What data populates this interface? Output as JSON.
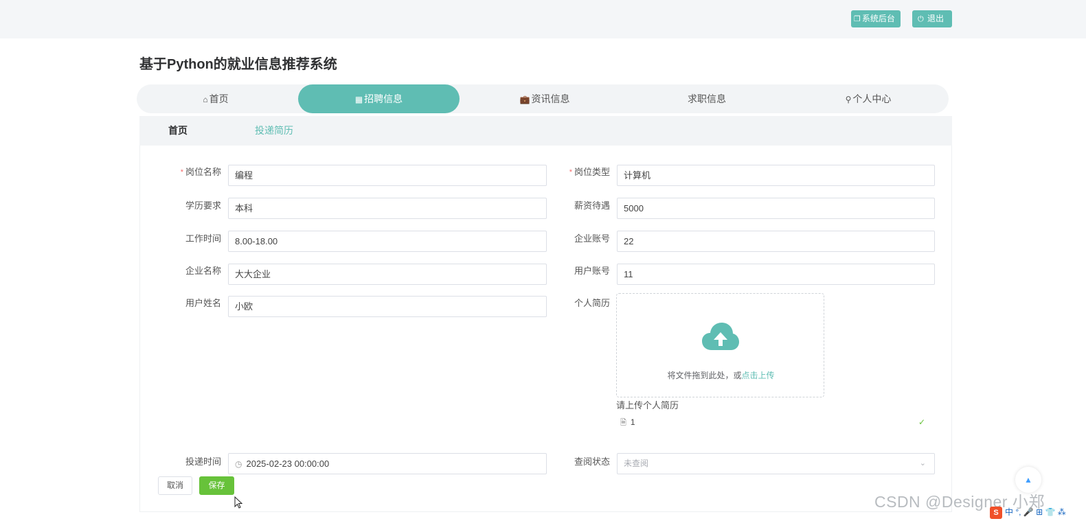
{
  "header": {
    "admin_label": "系统后台",
    "logout_label": "退出",
    "admin_icon": "copy-icon",
    "logout_icon": "power-icon"
  },
  "site_title": "基于Python的就业信息推荐系统",
  "nav": {
    "items": [
      {
        "label": "首页",
        "icon": "home-icon",
        "active": false
      },
      {
        "label": "招聘信息",
        "icon": "grid-icon",
        "active": true
      },
      {
        "label": "资讯信息",
        "icon": "briefcase-icon",
        "active": false
      },
      {
        "label": "求职信息",
        "icon": "",
        "active": false
      },
      {
        "label": "个人中心",
        "icon": "user-icon",
        "active": false
      }
    ]
  },
  "subtabs": {
    "home": "首页",
    "apply": "投递简历"
  },
  "form": {
    "job_name": {
      "label": "岗位名称",
      "value": "编程",
      "required": true
    },
    "job_type": {
      "label": "岗位类型",
      "value": "计算机",
      "required": true
    },
    "education": {
      "label": "学历要求",
      "value": "本科"
    },
    "salary": {
      "label": "薪资待遇",
      "value": "5000"
    },
    "work_time": {
      "label": "工作时间",
      "value": "8.00-18.00"
    },
    "company_account": {
      "label": "企业账号",
      "value": "22"
    },
    "company_name": {
      "label": "企业名称",
      "value": "大大企业"
    },
    "user_account": {
      "label": "用户账号",
      "value": "11"
    },
    "user_name": {
      "label": "用户姓名",
      "value": "小欧"
    },
    "resume": {
      "label": "个人简历",
      "upload_text": "将文件拖到此处，或",
      "upload_link": "点击上传",
      "tip": "请上传个人简历",
      "file_name": "1"
    },
    "submit_time": {
      "label": "投递时间",
      "value": "2025-02-23 00:00:00"
    },
    "review_status": {
      "label": "查阅状态",
      "value": "未查阅"
    }
  },
  "buttons": {
    "cancel": "取消",
    "save": "保存"
  },
  "watermark": "CSDN @Designer 小郑",
  "tray": {
    "logo": "S",
    "text": "中 °, 🎤 ⊞ 👕 ⁂"
  },
  "colors": {
    "accent": "#5fbdb3",
    "save": "#67c23a",
    "required": "#f56c6c"
  }
}
